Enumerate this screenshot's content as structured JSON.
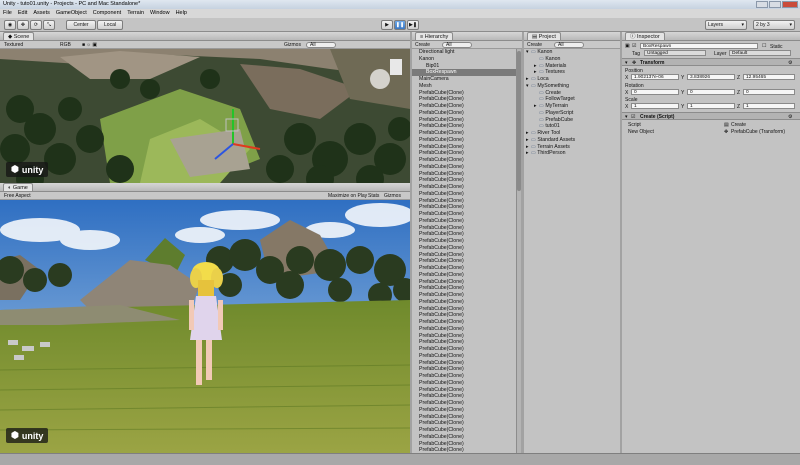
{
  "window": {
    "title": "Unity - tuto01.unity - Projects - PC and Mac Standalone*"
  },
  "menu": [
    "File",
    "Edit",
    "Assets",
    "GameObject",
    "Component",
    "Terrain",
    "Window",
    "Help"
  ],
  "toolbar": {
    "center_label": "Center",
    "local_label": "Local",
    "layers_label": "Layers",
    "layout_label": "2 by 3"
  },
  "scene": {
    "tab_label": "Scene",
    "shading": "Textured",
    "render_mode": "RGB",
    "gizmos_label": "Gizmos",
    "search_label": "All"
  },
  "game": {
    "tab_label": "Game",
    "aspect": "Free Aspect",
    "maximize_label": "Maximize on Play",
    "stats_label": "Stats",
    "gizmos_label": "Gizmos"
  },
  "logo_text": "unity",
  "hierarchy": {
    "tab_label": "Hierarchy",
    "create_label": "Create",
    "search_label": "All",
    "items": [
      {
        "label": "Directional light",
        "selected": false,
        "indent": 0
      },
      {
        "label": "Kanon",
        "selected": false,
        "indent": 0
      },
      {
        "label": "Bip01",
        "selected": false,
        "indent": 1
      },
      {
        "label": "BoxRespawn",
        "selected": true,
        "indent": 1
      },
      {
        "label": "MainCamera",
        "selected": false,
        "indent": 0
      },
      {
        "label": "Mesh",
        "selected": false,
        "indent": 0
      },
      {
        "label": "PrefabCube(Clone)",
        "selected": false,
        "indent": 0
      },
      {
        "label": "PrefabCube(Clone)",
        "selected": false,
        "indent": 0
      },
      {
        "label": "PrefabCube(Clone)",
        "selected": false,
        "indent": 0
      },
      {
        "label": "PrefabCube(Clone)",
        "selected": false,
        "indent": 0
      },
      {
        "label": "PrefabCube(Clone)",
        "selected": false,
        "indent": 0
      },
      {
        "label": "PrefabCube(Clone)",
        "selected": false,
        "indent": 0
      },
      {
        "label": "PrefabCube(Clone)",
        "selected": false,
        "indent": 0
      },
      {
        "label": "PrefabCube(Clone)",
        "selected": false,
        "indent": 0
      },
      {
        "label": "PrefabCube(Clone)",
        "selected": false,
        "indent": 0
      },
      {
        "label": "PrefabCube(Clone)",
        "selected": false,
        "indent": 0
      },
      {
        "label": "PrefabCube(Clone)",
        "selected": false,
        "indent": 0
      },
      {
        "label": "PrefabCube(Clone)",
        "selected": false,
        "indent": 0
      },
      {
        "label": "PrefabCube(Clone)",
        "selected": false,
        "indent": 0
      },
      {
        "label": "PrefabCube(Clone)",
        "selected": false,
        "indent": 0
      },
      {
        "label": "PrefabCube(Clone)",
        "selected": false,
        "indent": 0
      },
      {
        "label": "PrefabCube(Clone)",
        "selected": false,
        "indent": 0
      },
      {
        "label": "PrefabCube(Clone)",
        "selected": false,
        "indent": 0
      },
      {
        "label": "PrefabCube(Clone)",
        "selected": false,
        "indent": 0
      },
      {
        "label": "PrefabCube(Clone)",
        "selected": false,
        "indent": 0
      },
      {
        "label": "PrefabCube(Clone)",
        "selected": false,
        "indent": 0
      },
      {
        "label": "PrefabCube(Clone)",
        "selected": false,
        "indent": 0
      },
      {
        "label": "PrefabCube(Clone)",
        "selected": false,
        "indent": 0
      },
      {
        "label": "PrefabCube(Clone)",
        "selected": false,
        "indent": 0
      },
      {
        "label": "PrefabCube(Clone)",
        "selected": false,
        "indent": 0
      },
      {
        "label": "PrefabCube(Clone)",
        "selected": false,
        "indent": 0
      },
      {
        "label": "PrefabCube(Clone)",
        "selected": false,
        "indent": 0
      },
      {
        "label": "PrefabCube(Clone)",
        "selected": false,
        "indent": 0
      },
      {
        "label": "PrefabCube(Clone)",
        "selected": false,
        "indent": 0
      },
      {
        "label": "PrefabCube(Clone)",
        "selected": false,
        "indent": 0
      },
      {
        "label": "PrefabCube(Clone)",
        "selected": false,
        "indent": 0
      },
      {
        "label": "PrefabCube(Clone)",
        "selected": false,
        "indent": 0
      },
      {
        "label": "PrefabCube(Clone)",
        "selected": false,
        "indent": 0
      },
      {
        "label": "PrefabCube(Clone)",
        "selected": false,
        "indent": 0
      },
      {
        "label": "PrefabCube(Clone)",
        "selected": false,
        "indent": 0
      },
      {
        "label": "PrefabCube(Clone)",
        "selected": false,
        "indent": 0
      },
      {
        "label": "PrefabCube(Clone)",
        "selected": false,
        "indent": 0
      },
      {
        "label": "PrefabCube(Clone)",
        "selected": false,
        "indent": 0
      },
      {
        "label": "PrefabCube(Clone)",
        "selected": false,
        "indent": 0
      },
      {
        "label": "PrefabCube(Clone)",
        "selected": false,
        "indent": 0
      },
      {
        "label": "PrefabCube(Clone)",
        "selected": false,
        "indent": 0
      },
      {
        "label": "PrefabCube(Clone)",
        "selected": false,
        "indent": 0
      },
      {
        "label": "PrefabCube(Clone)",
        "selected": false,
        "indent": 0
      },
      {
        "label": "PrefabCube(Clone)",
        "selected": false,
        "indent": 0
      },
      {
        "label": "PrefabCube(Clone)",
        "selected": false,
        "indent": 0
      },
      {
        "label": "PrefabCube(Clone)",
        "selected": false,
        "indent": 0
      },
      {
        "label": "PrefabCube(Clone)",
        "selected": false,
        "indent": 0
      },
      {
        "label": "PrefabCube(Clone)",
        "selected": false,
        "indent": 0
      },
      {
        "label": "PrefabCube(Clone)",
        "selected": false,
        "indent": 0
      },
      {
        "label": "PrefabCube(Clone)",
        "selected": false,
        "indent": 0
      },
      {
        "label": "PrefabCube(Clone)",
        "selected": false,
        "indent": 0
      },
      {
        "label": "PrefabCube(Clone)",
        "selected": false,
        "indent": 0
      },
      {
        "label": "PrefabCube(Clone)",
        "selected": false,
        "indent": 0
      },
      {
        "label": "PrefabCube(Clone)",
        "selected": false,
        "indent": 0
      },
      {
        "label": "PrefabCube(Clone)",
        "selected": false,
        "indent": 0
      }
    ]
  },
  "project": {
    "tab_label": "Project",
    "create_label": "Create",
    "search_label": "All",
    "items": [
      {
        "label": "Kanon",
        "indent": 0,
        "arrow": "▾"
      },
      {
        "label": "Kanon",
        "indent": 1,
        "arrow": ""
      },
      {
        "label": "Materials",
        "indent": 1,
        "arrow": "▸"
      },
      {
        "label": "Textures",
        "indent": 1,
        "arrow": "▸"
      },
      {
        "label": "Loca",
        "indent": 0,
        "arrow": "▸"
      },
      {
        "label": "MySomething",
        "indent": 0,
        "arrow": "▾"
      },
      {
        "label": "Create",
        "indent": 1,
        "arrow": ""
      },
      {
        "label": "FollowTarget",
        "indent": 1,
        "arrow": ""
      },
      {
        "label": "MyTerrain",
        "indent": 1,
        "arrow": "▸"
      },
      {
        "label": "PlayerScript",
        "indent": 1,
        "arrow": ""
      },
      {
        "label": "PrefabCube",
        "indent": 1,
        "arrow": ""
      },
      {
        "label": "tuto01",
        "indent": 1,
        "arrow": ""
      },
      {
        "label": "River Tool",
        "indent": 0,
        "arrow": "▸"
      },
      {
        "label": "Standard Assets",
        "indent": 0,
        "arrow": "▸"
      },
      {
        "label": "Terrain Assets",
        "indent": 0,
        "arrow": "▸"
      },
      {
        "label": "ThirdPerson",
        "indent": 0,
        "arrow": "▸"
      }
    ]
  },
  "inspector": {
    "tab_label": "Inspector",
    "object_name": "BoxRespawn",
    "static_label": "Static",
    "tag_label": "Tag",
    "tag_value": "Untagged",
    "layer_label": "Layer",
    "layer_value": "Default",
    "transform_label": "Transform",
    "position_label": "Position",
    "position": {
      "x": "1.902137e-06",
      "y": "3.838926",
      "z": "12.95465"
    },
    "rotation_label": "Rotation",
    "rotation": {
      "x": "0",
      "y": "0",
      "z": "0"
    },
    "scale_label": "Scale",
    "scale": {
      "x": "1",
      "y": "1",
      "z": "1"
    },
    "axis_x": "X",
    "axis_y": "Y",
    "axis_z": "Z",
    "script_component_label": "Create (Script)",
    "script_label": "Script",
    "script_value": "Create",
    "new_object_label": "New Object",
    "new_object_value": "PrefabCube (Transform)"
  }
}
